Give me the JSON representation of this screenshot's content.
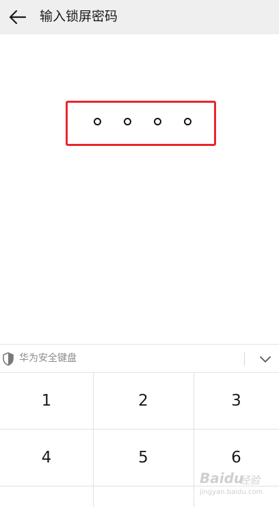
{
  "header": {
    "back_icon": "arrow-left-icon",
    "title": "输入锁屏密码"
  },
  "pin": {
    "length": 4,
    "filled": 0,
    "highlight_color": "#e8262b"
  },
  "keyboard": {
    "label": "华为安全键盘",
    "shield_icon": "shield-icon",
    "collapse_icon": "chevron-down-icon",
    "keys": [
      "1",
      "2",
      "3",
      "4",
      "5",
      "6"
    ]
  },
  "watermark": {
    "brand": "Baidu",
    "cn": "经验",
    "url": "jingyan.baidu.com"
  }
}
